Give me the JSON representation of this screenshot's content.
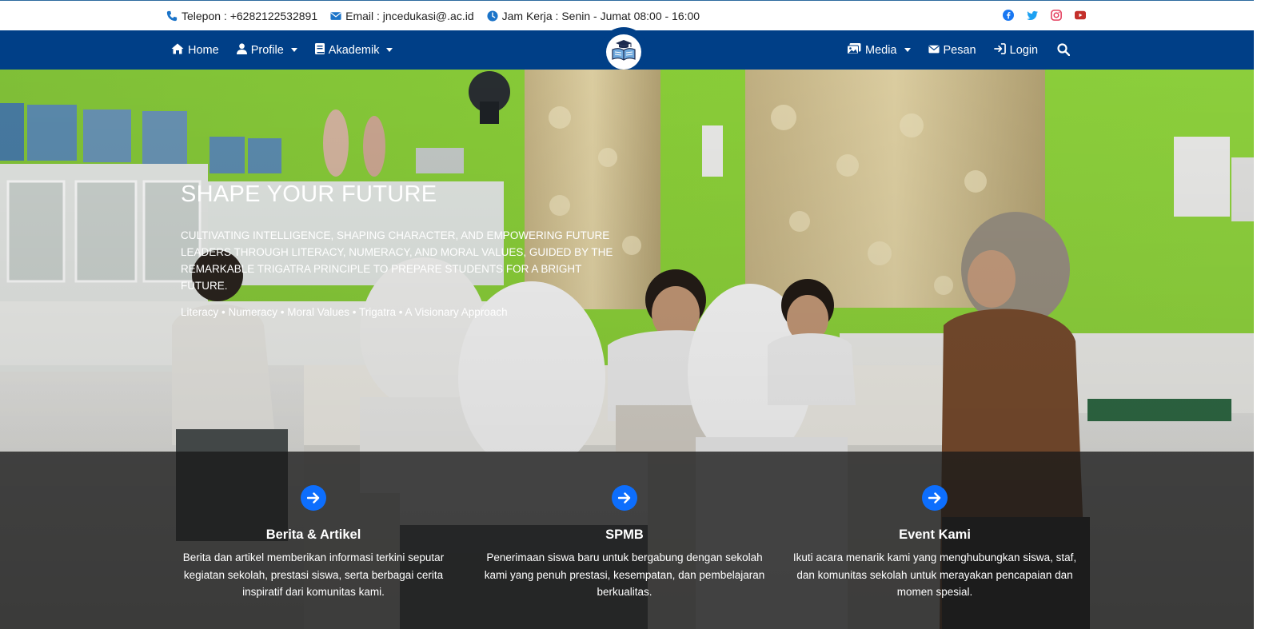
{
  "topbar": {
    "phone": "Telepon : +6282122532891",
    "email": "Email : jncedukasi@.ac.id",
    "hours": "Jam Kerja : Senin - Jumat 08:00 - 16:00",
    "social_icons": [
      "facebook-icon",
      "twitter-icon",
      "instagram-icon",
      "youtube-icon"
    ]
  },
  "nav": {
    "home": "Home",
    "profile": "Profile",
    "akademik": "Akademik",
    "media": "Media",
    "pesan": "Pesan",
    "login": "Login"
  },
  "hero": {
    "title": "SHAPE YOUR FUTURE",
    "description": "Cultivating intelligence, shaping character, and empowering future leaders through literacy, numeracy, and moral values, guided by the remarkable TRIGATRA principle to prepare students for a bright future.",
    "tags": "Literacy • Numeracy • Moral Values • Trigatra • A Visionary Approach"
  },
  "features": [
    {
      "title": "Berita & Artikel",
      "description": "Berita dan artikel memberikan informasi terkini seputar kegiatan sekolah, prestasi siswa, serta berbagai cerita inspiratif dari komunitas kami."
    },
    {
      "title": "SPMB",
      "description": "Penerimaan siswa baru untuk bergabung dengan sekolah kami yang penuh prestasi, kesempatan, dan pembelajaran berkualitas."
    },
    {
      "title": "Event Kami",
      "description": "Ikuti acara menarik kami yang menghubungkan siswa, staf, dan komunitas sekolah untuk merayakan pencapaian dan momen spesial."
    }
  ],
  "colors": {
    "navbar": "#003f87",
    "accent": "#0d6efd",
    "facebook": "#1877f2",
    "twitter": "#1da1f2",
    "instagram": "#e4405f",
    "youtube": "#c4302b",
    "wall_green": "#8fd63a"
  }
}
